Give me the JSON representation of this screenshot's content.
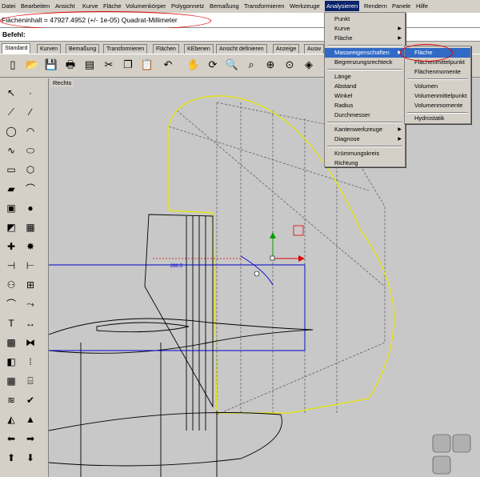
{
  "menubar": {
    "items": [
      "Datei",
      "Bearbeiten",
      "Ansicht",
      "Kurve",
      "Fläche",
      "Volumenkörper",
      "Polygonnetz",
      "Bemaßung",
      "Transformieren",
      "Werkzeuge",
      "Analysieren",
      "Rendern",
      "Panele",
      "Hilfe"
    ]
  },
  "command_history": {
    "text": "Flächeninhalt = 47927.4952 (+/- 1e-05) Quadrat-Millimeter"
  },
  "command_line": {
    "label": "Befehl:",
    "value": ""
  },
  "tabs": [
    "Standard",
    "Kurven",
    "Bemaßung",
    "Transformieren",
    "Flächen",
    "KEbenen",
    "Ansicht definieren",
    "Anzeige",
    "Ausw"
  ],
  "viewport": {
    "title": "Rechts",
    "dimension_label": "260.5"
  },
  "analysis_menu": {
    "items": [
      "Punkt",
      "Kurve",
      "Fläche",
      "Masseeigenschaften",
      "Begrenzungsrechteck",
      "Länge",
      "Abstand",
      "Winkel",
      "Radius",
      "Durchmesser",
      "Kantenwerkzeuge",
      "Diagnose",
      "Krümmungskreis",
      "Richtung"
    ]
  },
  "mass_submenu": {
    "items": [
      "Fläche",
      "Flächenmittelpunkt",
      "Flächenmomente",
      "Volumen",
      "Volumenmittelpunkt",
      "Volumenmomente",
      "Hydrostatik"
    ]
  },
  "colors": {
    "menu_highlight": "#3169c6",
    "annotation": "#e00000",
    "curve_yellow": "#e8e800",
    "axis_blue": "#0000cc"
  },
  "icons": [
    "new-icon",
    "open-icon",
    "save-icon",
    "print-icon",
    "import-icon",
    "cut-icon",
    "copy-icon",
    "paste-icon",
    "undo-icon",
    "pan-icon",
    "rotate-icon",
    "zoom-icon",
    "zoom-window-icon",
    "zoom-extents-icon",
    "zoom-selected-icon",
    "select-icon"
  ]
}
